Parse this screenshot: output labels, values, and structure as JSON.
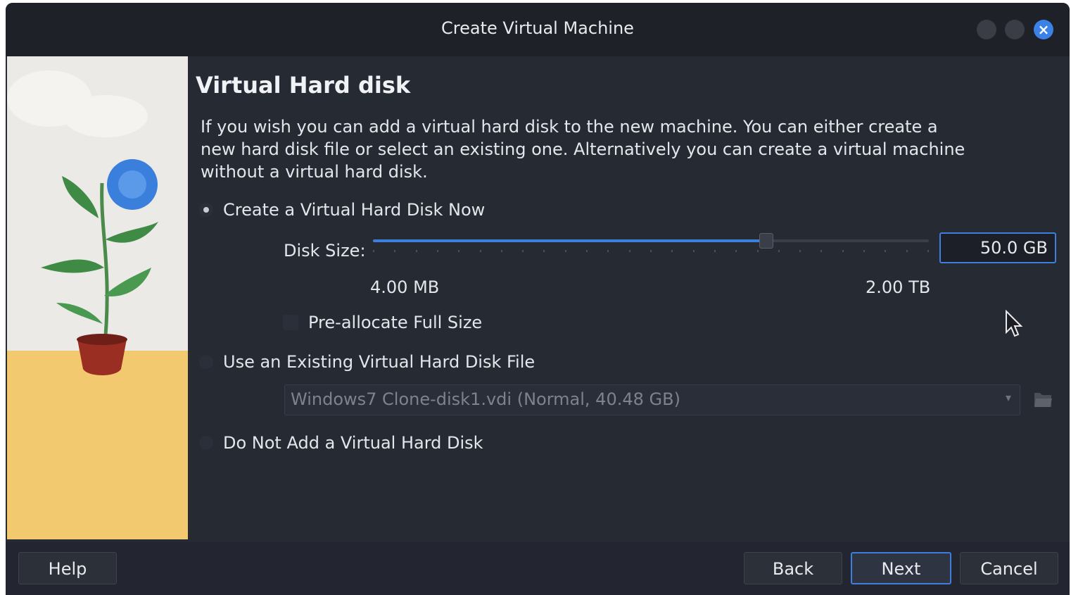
{
  "window": {
    "title": "Create Virtual Machine"
  },
  "page": {
    "heading": "Virtual Hard disk",
    "description": "If you wish you can add a virtual hard disk to the new machine. You can either create a new hard disk file or select an existing one. Alternatively you can create a virtual machine without a virtual hard disk."
  },
  "options": {
    "create_new": {
      "label": "Create a Virtual Hard Disk Now",
      "selected": true
    },
    "use_existing": {
      "label": "Use an Existing Virtual Hard Disk File",
      "selected": false
    },
    "no_disk": {
      "label": "Do Not Add a Virtual Hard Disk",
      "selected": false
    }
  },
  "disk_size": {
    "label": "Disk Size:",
    "value": "50.0 GB",
    "min_label": "4.00 MB",
    "max_label": "2.00 TB",
    "slider_fraction": 0.706
  },
  "preallocate": {
    "label": "Pre-allocate Full Size",
    "checked": false
  },
  "existing_file": {
    "value": "Windows7 Clone-disk1.vdi (Normal, 40.48 GB)"
  },
  "buttons": {
    "help": "Help",
    "back": "Back",
    "next": "Next",
    "cancel": "Cancel"
  },
  "colors": {
    "accent": "#3d7fdc",
    "background": "#262a33",
    "close_button": "#3b82e6"
  },
  "icons": {
    "close": "close-icon",
    "folder": "folder-open-icon",
    "dropdown": "chevron-down-icon"
  }
}
